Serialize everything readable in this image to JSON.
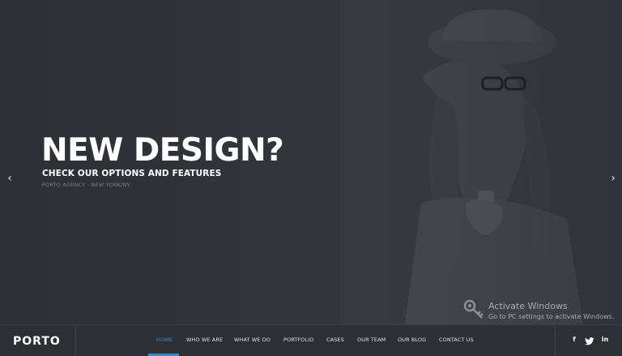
{
  "hero": {
    "headline": "NEW DESIGN?",
    "subheadline": "CHECK OUR OPTIONS AND FEATURES",
    "tagline": "PORTO AGENCY - NEW YORK/NY",
    "prev_arrow": "‹",
    "next_arrow": "›",
    "overlay_color": "#2b2e33"
  },
  "watermark": {
    "title": "Activate Windows",
    "subtitle": "Go to PC settings to activate Windows."
  },
  "navbar": {
    "logo": "PORTO",
    "items": [
      {
        "label": "HOME",
        "active": true
      },
      {
        "label": "WHO WE ARE",
        "active": false
      },
      {
        "label": "WHAT WE DO",
        "active": false
      },
      {
        "label": "PORTFOLIO",
        "active": false
      },
      {
        "label": "CASES",
        "active": false
      },
      {
        "label": "OUR TEAM",
        "active": false
      },
      {
        "label": "OUR BLOG",
        "active": false
      },
      {
        "label": "CONTACT US",
        "active": false
      }
    ],
    "social": [
      {
        "icon": "facebook-icon",
        "glyph": "f"
      },
      {
        "icon": "twitter-icon",
        "glyph": "🐦"
      },
      {
        "icon": "linkedin-icon",
        "glyph": "in"
      }
    ],
    "accent_color": "#2c8fd6",
    "background_color": "#2c2f34"
  }
}
